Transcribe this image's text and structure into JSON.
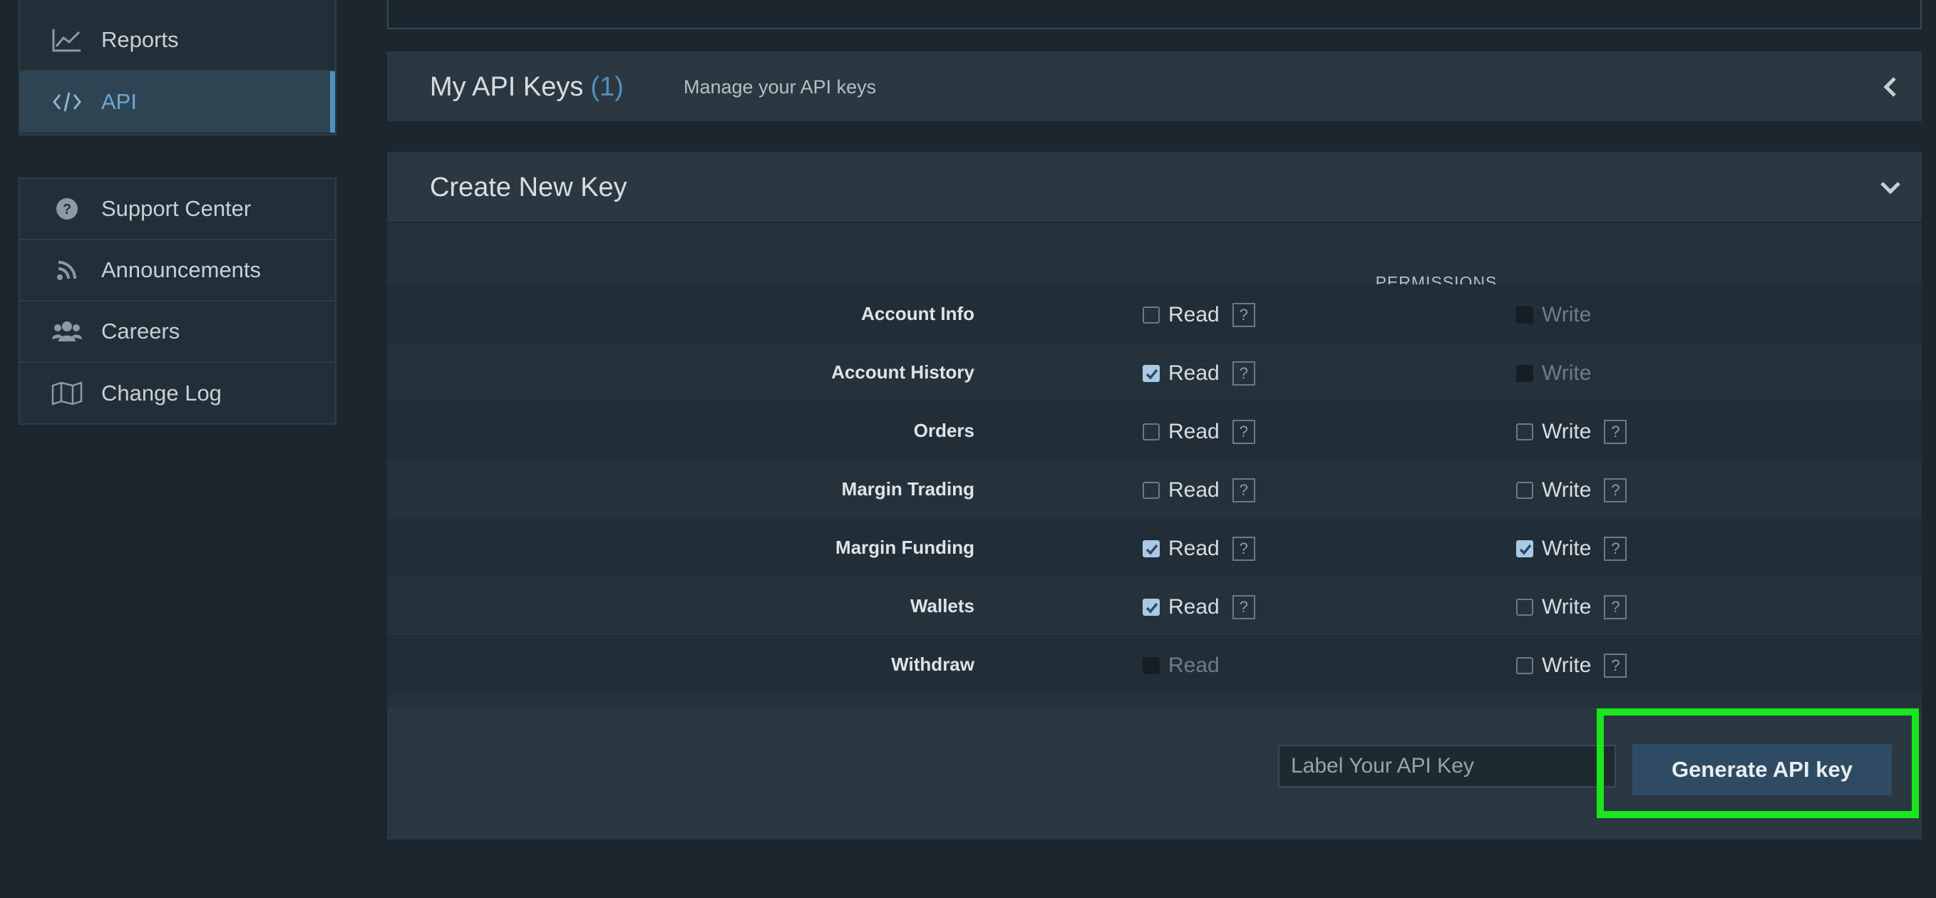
{
  "sidebar": {
    "top_items": [
      {
        "label": "Reports",
        "icon": "line-chart-icon",
        "active": false
      },
      {
        "label": "API",
        "icon": "code-icon",
        "active": true
      }
    ],
    "bottom_items": [
      {
        "label": "Support Center",
        "icon": "question-circle-icon"
      },
      {
        "label": "Announcements",
        "icon": "rss-icon"
      },
      {
        "label": "Careers",
        "icon": "users-icon"
      },
      {
        "label": "Change Log",
        "icon": "map-icon"
      }
    ]
  },
  "my_keys": {
    "title": "My API Keys",
    "count": "(1)",
    "subtitle": "Manage your API keys"
  },
  "create_key": {
    "title": "Create New Key",
    "permissions_header": "PERMISSIONS",
    "read_label": "Read",
    "write_label": "Write",
    "help_glyph": "?",
    "rows": [
      {
        "label": "Account Info",
        "read": {
          "checked": false,
          "disabled": false
        },
        "write": {
          "checked": false,
          "disabled": true
        }
      },
      {
        "label": "Account History",
        "read": {
          "checked": true,
          "disabled": false
        },
        "write": {
          "checked": false,
          "disabled": true
        }
      },
      {
        "label": "Orders",
        "read": {
          "checked": false,
          "disabled": false
        },
        "write": {
          "checked": false,
          "disabled": false
        }
      },
      {
        "label": "Margin Trading",
        "read": {
          "checked": false,
          "disabled": false
        },
        "write": {
          "checked": false,
          "disabled": false
        }
      },
      {
        "label": "Margin Funding",
        "read": {
          "checked": true,
          "disabled": false
        },
        "write": {
          "checked": true,
          "disabled": false
        }
      },
      {
        "label": "Wallets",
        "read": {
          "checked": true,
          "disabled": false
        },
        "write": {
          "checked": false,
          "disabled": false
        }
      },
      {
        "label": "Withdraw",
        "read": {
          "checked": false,
          "disabled": true
        },
        "write": {
          "checked": false,
          "disabled": false
        }
      }
    ],
    "label_input": {
      "placeholder": "Label Your API Key",
      "value": ""
    },
    "generate_button": "Generate API key"
  },
  "colors": {
    "accent": "#4f90c3",
    "highlight": "#19e61c"
  }
}
